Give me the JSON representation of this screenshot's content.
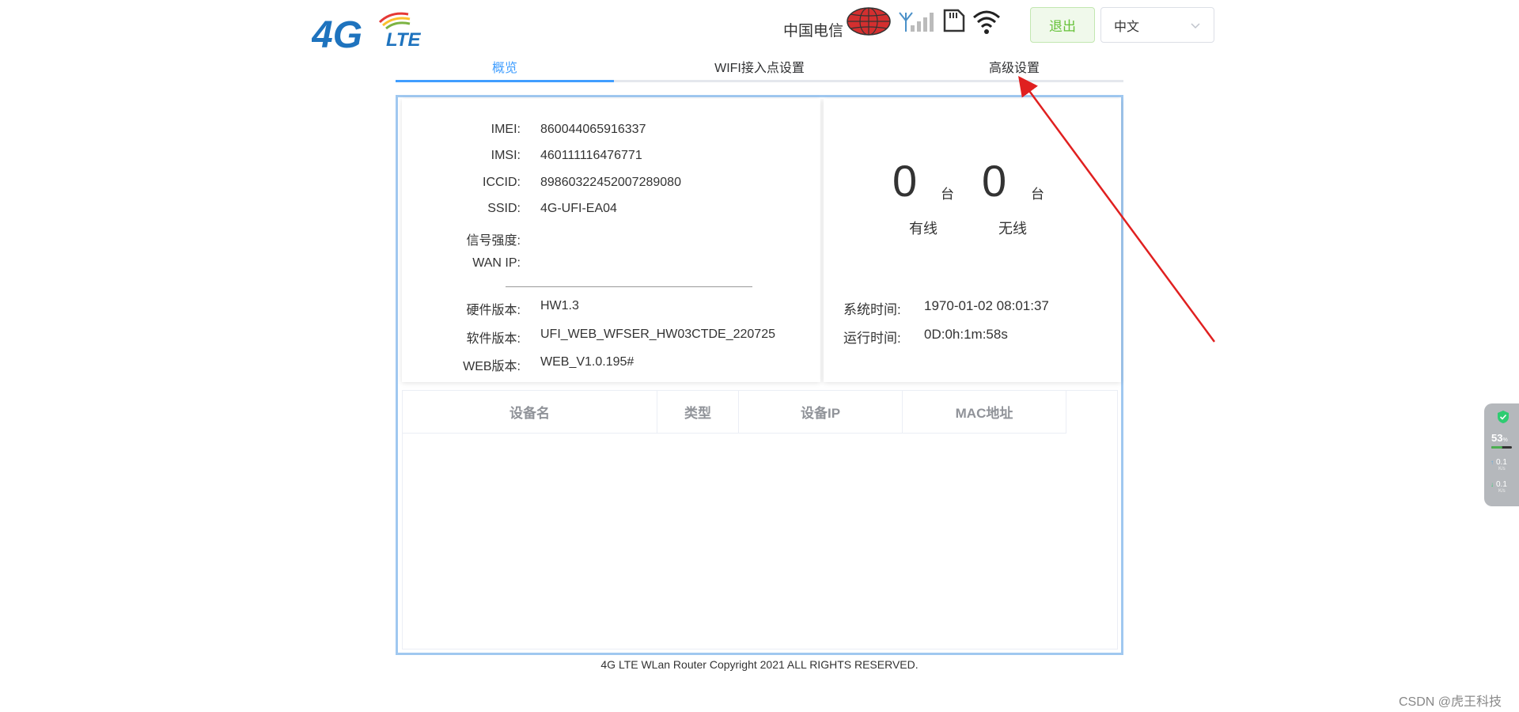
{
  "header": {
    "logo_text": "4GLTE",
    "carrier": "中国电信",
    "logout_label": "退出",
    "language_value": "中文"
  },
  "tabs": [
    {
      "label": "概览",
      "active": true
    },
    {
      "label": "WIFI接入点设置",
      "active": false
    },
    {
      "label": "高级设置",
      "active": false
    }
  ],
  "device_info": {
    "rows": [
      {
        "label": "IMEI:",
        "value": "860044065916337"
      },
      {
        "label": "IMSI:",
        "value": "460111116476771"
      },
      {
        "label": "ICCID:",
        "value": "89860322452007289080"
      },
      {
        "label": "SSID:",
        "value": "4G-UFI-EA04"
      },
      {
        "label": "信号强度:",
        "value": ""
      },
      {
        "label": "WAN IP:",
        "value": ""
      }
    ],
    "version_rows": [
      {
        "label": "硬件版本:",
        "value": "HW1.3"
      },
      {
        "label": "软件版本:",
        "value": "UFI_WEB_WFSER_HW03CTDE_220725"
      },
      {
        "label": "WEB版本:",
        "value": "WEB_V1.0.195#"
      }
    ]
  },
  "stats": {
    "wired_count": "0",
    "wireless_count": "0",
    "unit": "台",
    "wired_label": "有线",
    "wireless_label": "无线",
    "system_time_label": "系统时间:",
    "system_time_value": "1970-01-02 08:01:37",
    "uptime_label": "运行时间:",
    "uptime_value": "0D:0h:1m:58s"
  },
  "device_table": {
    "columns": [
      "设备名",
      "类型",
      "设备IP",
      "MAC地址"
    ],
    "rows": []
  },
  "footer": {
    "copyright": "4G LTE WLan Router Copyright 2021 ALL RIGHTS RESERVED."
  },
  "widget": {
    "percent": "53",
    "percent_symbol": "%",
    "percent_fraction": 0.53,
    "upload": "0.1",
    "download": "0.1",
    "rate_unit": "K/s"
  },
  "watermark": "CSDN @虎王科技",
  "colors": {
    "accent": "#409eff",
    "logout_green": "#67c23a",
    "panel_border": "#a0c8f0",
    "annotation_red": "#e02020"
  }
}
